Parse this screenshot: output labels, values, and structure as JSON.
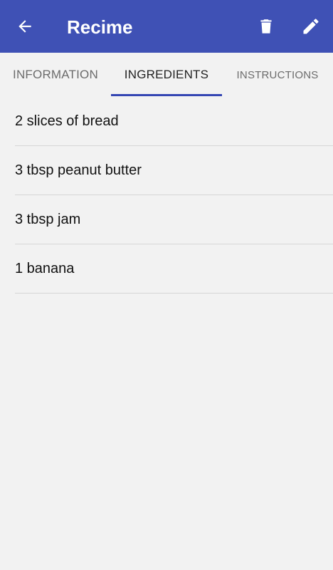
{
  "app": {
    "title": "Recime"
  },
  "toolbar": {
    "back_icon": "arrow-left-icon",
    "delete_icon": "trash-icon",
    "edit_icon": "pencil-icon",
    "background_color": "#3f51b5"
  },
  "tabs": [
    {
      "label": "INFORMATION",
      "selected": false
    },
    {
      "label": "INGREDIENTS",
      "selected": true
    },
    {
      "label": "INSTRUCTIONS",
      "selected": false
    }
  ],
  "ingredients": [
    {
      "text": "2 slices of bread"
    },
    {
      "text": "3 tbsp peanut butter"
    },
    {
      "text": "3 tbsp jam"
    },
    {
      "text": "1 banana"
    }
  ]
}
